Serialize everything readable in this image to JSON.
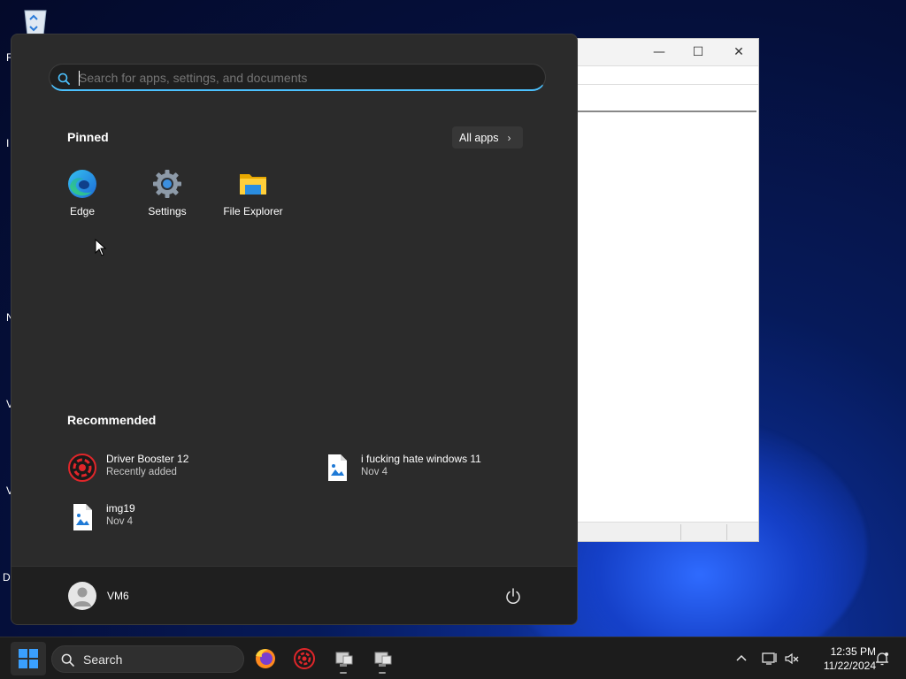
{
  "start_menu": {
    "search": {
      "placeholder": "Search for apps, settings, and documents",
      "value": ""
    },
    "pinned": {
      "title": "Pinned",
      "all_apps_label": "All apps",
      "apps": [
        {
          "label": "Edge",
          "icon": "edge-icon"
        },
        {
          "label": "Settings",
          "icon": "gear-icon"
        },
        {
          "label": "File Explorer",
          "icon": "folder-icon"
        }
      ]
    },
    "recommended": {
      "title": "Recommended",
      "items": [
        {
          "name": "Driver Booster 12",
          "sub": "Recently added",
          "icon": "driver-booster-icon"
        },
        {
          "name": "i fucking hate windows 11",
          "sub": "Nov 4",
          "icon": "image-file-icon"
        },
        {
          "name": "img19",
          "sub": "Nov 4",
          "icon": "image-file-icon"
        }
      ]
    },
    "user": {
      "name": "VM6"
    }
  },
  "taskbar": {
    "search_label": "Search",
    "clock": {
      "time": "12:35 PM",
      "date": "11/22/2024"
    }
  },
  "colors": {
    "accent": "#4cc2ff",
    "menu_bg": "#2b2b2b",
    "taskbar_bg": "#1c1c1c"
  }
}
